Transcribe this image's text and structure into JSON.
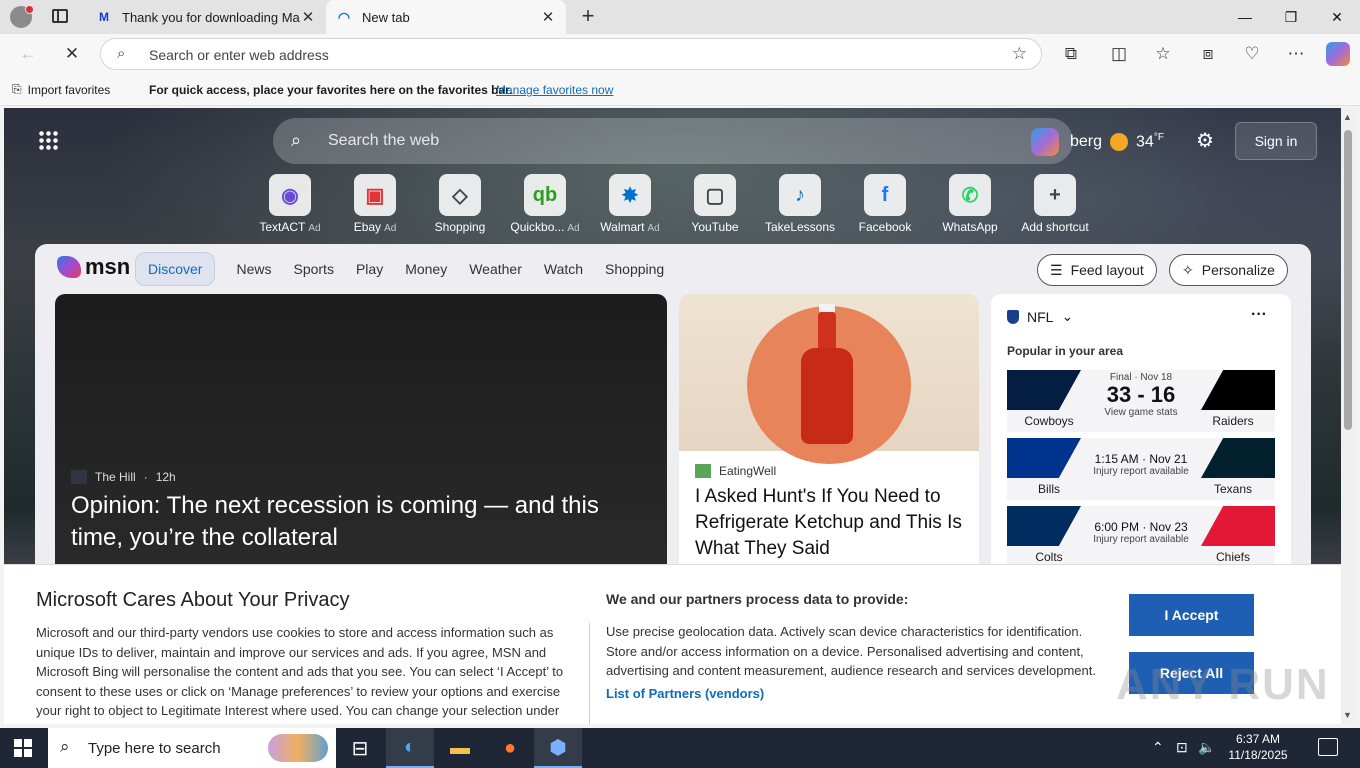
{
  "browser": {
    "tabs": [
      {
        "title": "Thank you for downloading Malw",
        "favicon": "M"
      },
      {
        "title": "New tab",
        "favicon": "spinner"
      }
    ],
    "address": {
      "placeholder": "Search or enter web address"
    },
    "favbar": {
      "import_label": "Import favorites",
      "message": "For quick access, place your favorites here on the favorites bar.",
      "manage_link": "Manage favorites now"
    }
  },
  "newtab": {
    "search_placeholder": "Search the web",
    "weather": {
      "location": "berg",
      "temp": "34",
      "unit": "°F"
    },
    "sign_in": "Sign in",
    "shortcuts": [
      {
        "name": "TextACT",
        "ad": "Ad",
        "icon": "textact-icon",
        "glyph": "◉",
        "color": "#6a4bd8"
      },
      {
        "name": "Ebay",
        "ad": "Ad",
        "icon": "ebay-icon",
        "glyph": "▣",
        "color": "#e53238"
      },
      {
        "name": "Shopping",
        "ad": "",
        "icon": "tag-icon",
        "glyph": "◇",
        "color": "#444"
      },
      {
        "name": "Quickbo...",
        "ad": "Ad",
        "icon": "quickbooks-icon",
        "glyph": "qb",
        "color": "#2ca01c"
      },
      {
        "name": "Walmart",
        "ad": "Ad",
        "icon": "walmart-icon",
        "glyph": "✸",
        "color": "#0071ce"
      },
      {
        "name": "YouTube",
        "ad": "",
        "icon": "youtube-icon",
        "glyph": "▢",
        "color": "#444"
      },
      {
        "name": "TakeLessons",
        "ad": "",
        "icon": "takelessons-icon",
        "glyph": "♪",
        "color": "#1a6fc0"
      },
      {
        "name": "Facebook",
        "ad": "",
        "icon": "facebook-icon",
        "glyph": "f",
        "color": "#1877f2"
      },
      {
        "name": "WhatsApp",
        "ad": "",
        "icon": "whatsapp-icon",
        "glyph": "✆",
        "color": "#25d366"
      },
      {
        "name": "Add shortcut",
        "ad": "",
        "icon": "plus-icon",
        "glyph": "+",
        "color": "#444"
      }
    ],
    "msn": {
      "logo": "msn",
      "tabs": [
        "Discover",
        "News",
        "Sports",
        "Play",
        "Money",
        "Weather",
        "Watch",
        "Shopping"
      ],
      "feed_layout": "Feed layout",
      "personalize": "Personalize"
    },
    "cards": {
      "hero": {
        "source": "The Hill",
        "age": "12h",
        "headline": "Opinion: The next recession is coming — and this time, you’re the collateral"
      },
      "food": {
        "source": "EatingWell",
        "headline": "I Asked Hunt's If You Need to Refrigerate Ketchup and This Is What They Said"
      },
      "nfl": {
        "league": "NFL",
        "subtitle": "Popular in your area",
        "games": [
          {
            "team1": "Cowboys",
            "team2": "Raiders",
            "status": "Final · Nov 18",
            "score": "33 - 16",
            "note": "View game stats",
            "c1": "#041e42",
            "c2": "#000000"
          },
          {
            "team1": "Bills",
            "team2": "Texans",
            "status": "",
            "score": "1:15 AM · Nov 21",
            "note": "Injury report available",
            "c1": "#00338d",
            "c2": "#03202f"
          },
          {
            "team1": "Colts",
            "team2": "Chiefs",
            "status": "",
            "score": "6:00 PM · Nov 23",
            "note": "Injury report available",
            "c1": "#002c5f",
            "c2": "#e31837"
          }
        ]
      }
    }
  },
  "privacy": {
    "title": "Microsoft Cares About Your Privacy",
    "body": "Microsoft and our third-party vendors use cookies to store and access information such as unique IDs to deliver, maintain and improve our services and ads. If you agree, MSN and Microsoft Bing will personalise the content and ads that you see. You can select ‘I Accept’ to consent to these uses or click on ‘Manage preferences’ to review your options and exercise your right to object to Legitimate Interest where used.  You can change your selection under",
    "process_title": "We and our partners process data to provide:",
    "process_body": "Use precise geolocation data. Actively scan device characteristics for identification. Store and/or access information on a device. Personalised advertising and content, advertising and content measurement, audience research and services development.",
    "partners_link": "List of Partners (vendors)",
    "accept": "I Accept",
    "reject": "Reject All"
  },
  "watermark": "ANY RUN",
  "taskbar": {
    "search_placeholder": "Type here to search",
    "time": "6:37 AM",
    "date": "11/18/2025"
  }
}
